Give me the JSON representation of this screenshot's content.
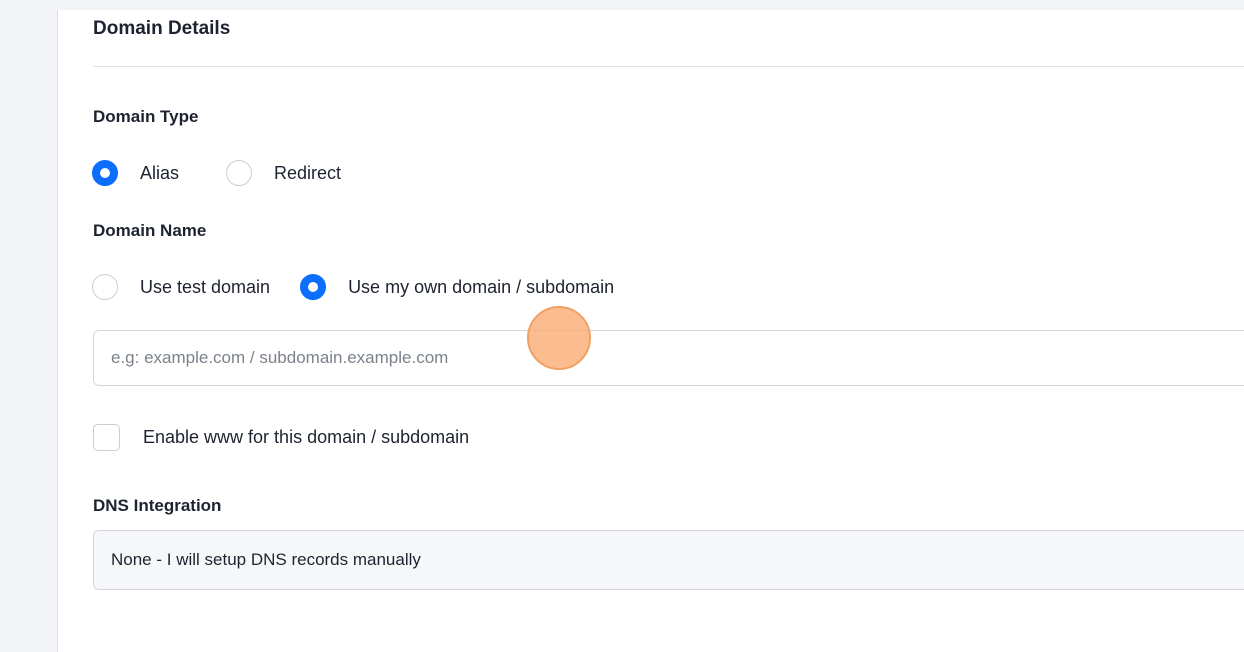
{
  "section": {
    "title": "Domain Details"
  },
  "domain_type": {
    "label": "Domain Type",
    "options": [
      {
        "label": "Alias",
        "checked": true
      },
      {
        "label": "Redirect",
        "checked": false
      }
    ]
  },
  "domain_name": {
    "label": "Domain Name",
    "options": [
      {
        "label": "Use test domain",
        "checked": false
      },
      {
        "label": "Use my own domain / subdomain",
        "checked": true
      }
    ],
    "input": {
      "value": "",
      "placeholder": "e.g: example.com / subdomain.example.com"
    },
    "www_checkbox": {
      "label": "Enable www for this domain / subdomain",
      "checked": false
    }
  },
  "dns_integration": {
    "label": "DNS Integration",
    "selected": "None - I will setup DNS records manually"
  },
  "colors": {
    "accent": "#0b6efd",
    "click_indicator": "#f8ad78",
    "background": "#f3f4f7"
  }
}
